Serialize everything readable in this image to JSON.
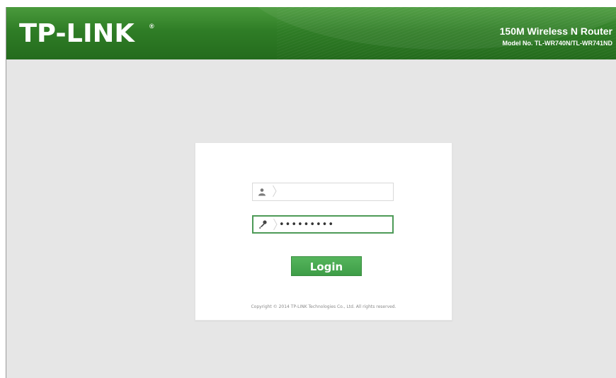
{
  "brand": {
    "logo_text": "TP-LINK",
    "registered_mark": "®",
    "product_name": "150M Wireless N Router",
    "model": "Model No. TL-WR740N/TL-WR741ND"
  },
  "login": {
    "username": {
      "icon": "user-icon",
      "value": "",
      "placeholder": ""
    },
    "password": {
      "icon": "key-icon",
      "value": "•••••••••",
      "placeholder": ""
    },
    "button_label": "Login",
    "copyright": "Copyright © 2014 TP-LINK Technologies Co., Ltd. All rights reserved."
  },
  "colors": {
    "header_green": "#2f7d26",
    "button_green": "#4aa852",
    "page_background": "#e6e6e6",
    "active_field_border": "#4d9a57"
  }
}
